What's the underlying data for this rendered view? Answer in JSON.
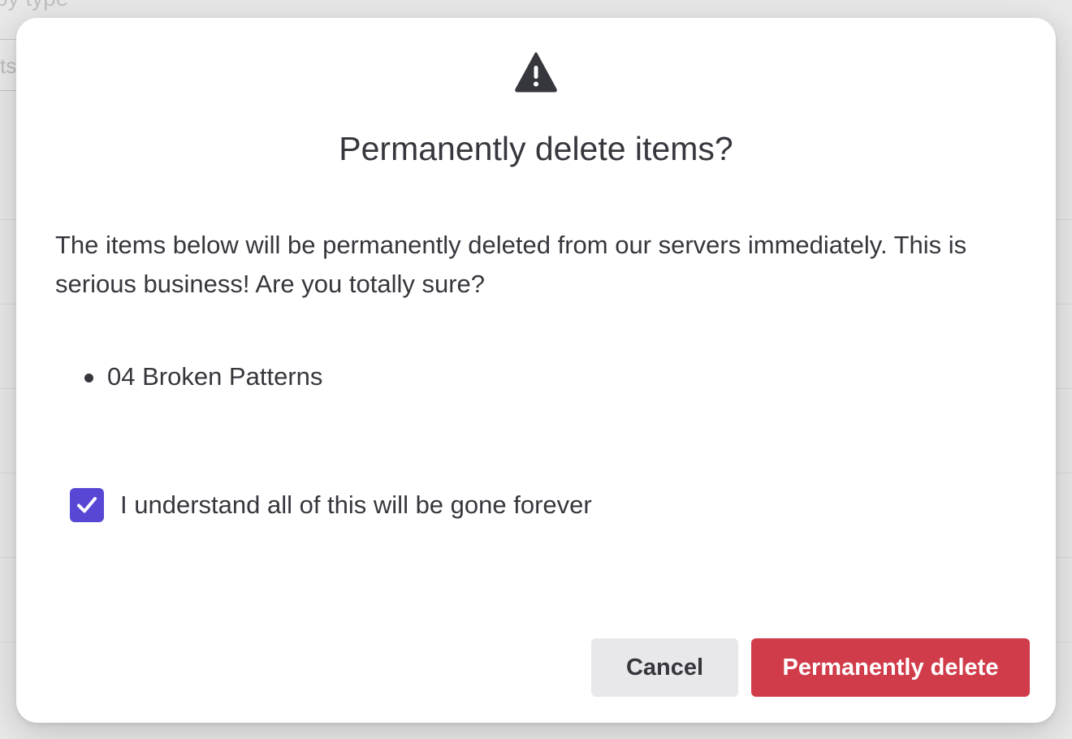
{
  "background": {
    "filter_text": "by type",
    "input_text": "ts"
  },
  "dialog": {
    "icon": "warning-triangle-icon",
    "title": "Permanently delete items?",
    "message": "The items below will be permanently deleted from our servers immediately. This is serious business! Are you totally sure?",
    "items": [
      "04 Broken Patterns"
    ],
    "confirm_label": "I understand all of this will be gone forever",
    "confirm_checked": true,
    "cancel_label": "Cancel",
    "delete_label": "Permanently delete"
  },
  "colors": {
    "accent_checkbox": "#5747d4",
    "danger": "#d13c4b",
    "cancel_bg": "#e8e8eb",
    "text": "#36373d"
  }
}
